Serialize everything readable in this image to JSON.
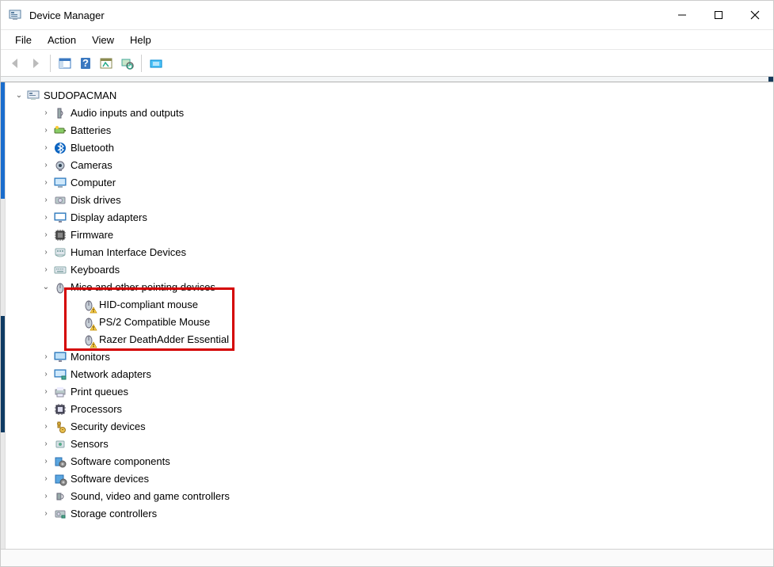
{
  "window": {
    "title": "Device Manager"
  },
  "menu": {
    "file": "File",
    "action": "Action",
    "view": "View",
    "help": "Help"
  },
  "root": {
    "name": "SUDOPACMAN"
  },
  "categories": [
    {
      "label": "Audio inputs and outputs",
      "icon": "speaker"
    },
    {
      "label": "Batteries",
      "icon": "battery"
    },
    {
      "label": "Bluetooth",
      "icon": "bluetooth"
    },
    {
      "label": "Cameras",
      "icon": "camera"
    },
    {
      "label": "Computer",
      "icon": "computer"
    },
    {
      "label": "Disk drives",
      "icon": "disk"
    },
    {
      "label": "Display adapters",
      "icon": "display"
    },
    {
      "label": "Firmware",
      "icon": "chip"
    },
    {
      "label": "Human Interface Devices",
      "icon": "hid"
    },
    {
      "label": "Keyboards",
      "icon": "keyboard"
    },
    {
      "label": "Mice and other pointing devices",
      "icon": "mouse",
      "expanded": true
    },
    {
      "label": "Monitors",
      "icon": "monitor"
    },
    {
      "label": "Network adapters",
      "icon": "network"
    },
    {
      "label": "Print queues",
      "icon": "printer"
    },
    {
      "label": "Processors",
      "icon": "cpu"
    },
    {
      "label": "Security devices",
      "icon": "security"
    },
    {
      "label": "Sensors",
      "icon": "sensor"
    },
    {
      "label": "Software components",
      "icon": "swcomp"
    },
    {
      "label": "Software devices",
      "icon": "swdev"
    },
    {
      "label": "Sound, video and game controllers",
      "icon": "sound"
    },
    {
      "label": "Storage controllers",
      "icon": "storage"
    }
  ],
  "mice_children": [
    {
      "label": "HID-compliant mouse",
      "warn": true
    },
    {
      "label": "PS/2 Compatible Mouse",
      "warn": true
    },
    {
      "label": "Razer DeathAdder Essential",
      "warn": true
    }
  ]
}
